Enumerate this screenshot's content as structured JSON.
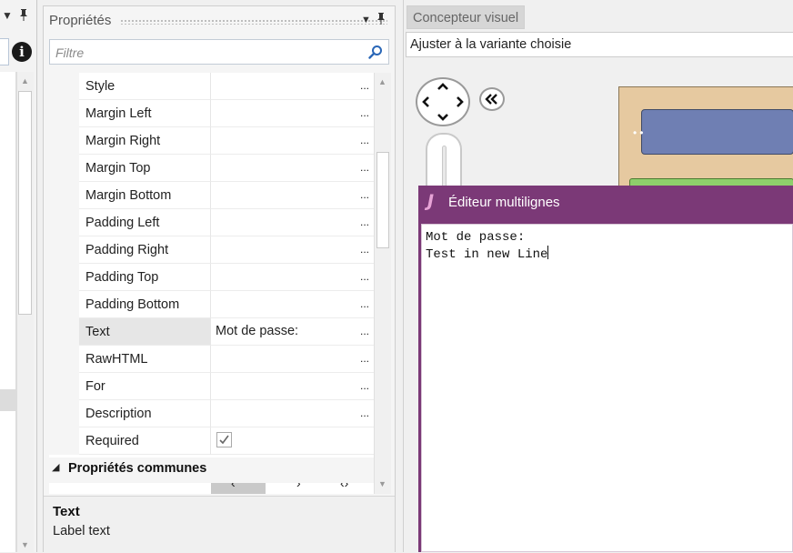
{
  "left_pane": {
    "dropdown_glyph": "▼",
    "pin_glyph": "📌",
    "info_label": "i"
  },
  "properties": {
    "title": "Propriétés",
    "filter_placeholder": "Filtre",
    "ellipsis": "...",
    "rows": [
      {
        "name": "Style",
        "value": ""
      },
      {
        "name": "Margin Left",
        "value": ""
      },
      {
        "name": "Margin Right",
        "value": ""
      },
      {
        "name": "Margin Top",
        "value": ""
      },
      {
        "name": "Margin Bottom",
        "value": ""
      },
      {
        "name": "Padding Left",
        "value": ""
      },
      {
        "name": "Padding Right",
        "value": ""
      },
      {
        "name": "Padding Top",
        "value": ""
      },
      {
        "name": "Padding Bottom",
        "value": ""
      },
      {
        "name": "Text",
        "value": "Mot de passe:"
      },
      {
        "name": "RawHTML",
        "value": ""
      },
      {
        "name": "For",
        "value": ""
      },
      {
        "name": "Description",
        "value": ""
      },
      {
        "name": "Required",
        "value": "",
        "checked": true
      }
    ],
    "category": "Propriétés communes",
    "description": {
      "title": "Text",
      "text": "Label text"
    }
  },
  "designer": {
    "tab_label": "Concepteur visuel",
    "variant_label": "Ajuster à la variante choisie"
  },
  "editor": {
    "icon_label": "J",
    "title": "Éditeur multilignes",
    "line1": "Mot de passe:",
    "line2": "Test in new Line"
  },
  "colors": {
    "editor_titlebar": "#7b3977",
    "form_background": "#e6c9a0",
    "field_blue": "#6f7fb3",
    "field_green": "#8ecf6b"
  },
  "icons": [
    "search-icon",
    "info-icon",
    "pin-icon",
    "dropdown-arrow-icon",
    "pan-navigation-icon",
    "collapse-double-chevron-icon",
    "checkbox-checked-icon",
    "collapse-triangle-icon"
  ]
}
